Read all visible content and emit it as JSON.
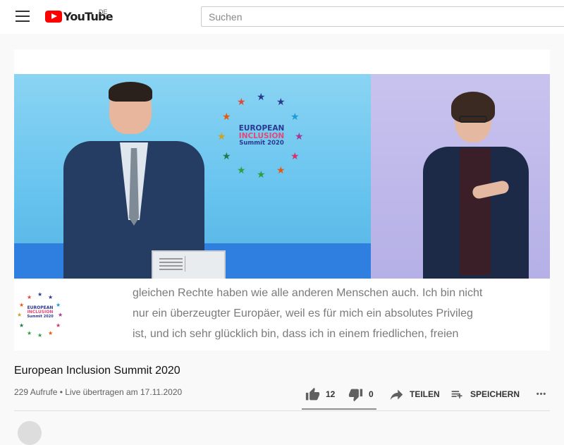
{
  "header": {
    "logo_text": "YouTube",
    "country_code": "DE",
    "search_placeholder": "Suchen"
  },
  "video": {
    "logo": {
      "line1": "EUROPEAN",
      "line2": "INCLUSION",
      "line3": "Summit 2020"
    },
    "captions": [
      "gleichen Rechte haben wie alle anderen Menschen auch. Ich bin nicht",
      "nur ein überzeugter Europäer, weil es für mich ein absolutes Privileg",
      "ist, und ich sehr glücklich bin, dass ich in einem friedlichen, freien"
    ]
  },
  "info": {
    "title": "European Inclusion Summit 2020",
    "views": "229 Aufrufe",
    "separator": "•",
    "date": "Live übertragen am 17.11.2020"
  },
  "actions": {
    "like_count": "12",
    "dislike_count": "0",
    "share_label": "TEILEN",
    "save_label": "SPEICHERN",
    "more_label": "•••"
  },
  "colors": {
    "brand": "#ff0000",
    "rainbow": [
      "#3b78d8",
      "#2f9e44",
      "#f2b90d",
      "#e8590c",
      "#d6336c",
      "#8d3ea3",
      "#1f7a4d"
    ]
  }
}
